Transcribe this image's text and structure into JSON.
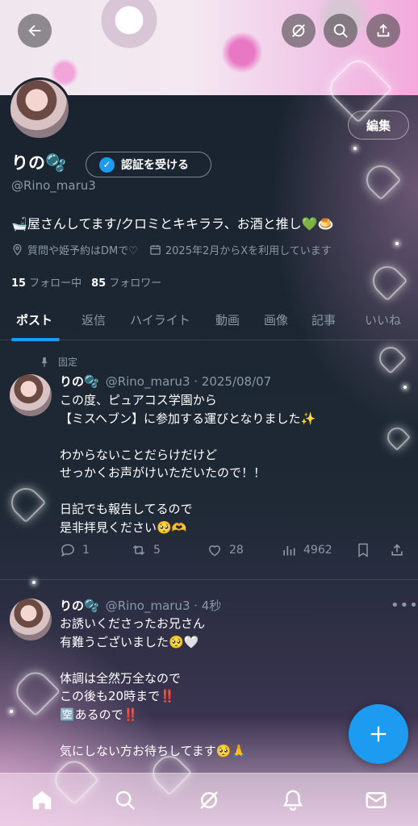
{
  "topbar": {
    "back_icon": "arrow-left-icon",
    "grok_icon": "grok-icon",
    "search_icon": "search-icon",
    "share_icon": "share-icon"
  },
  "profile": {
    "display_name": "りの🫧",
    "edit_label": "編集",
    "verify_label": "認証を受ける",
    "handle": "@Rino_maru3",
    "bio": "🛁屋さんしてます/クロミとキキララ、お酒と推し💚🍮",
    "info_note": "質問や姫予約はDMで♡",
    "joined": "2025年2月からXを利用しています",
    "following_count": "15",
    "following_label": "フォロー中",
    "followers_count": "85",
    "followers_label": "フォロワー"
  },
  "tabs": [
    "ポスト",
    "返信",
    "ハイライト",
    "動画",
    "画像",
    "記事",
    "いいね"
  ],
  "active_tab": "ポスト",
  "posts": [
    {
      "pinned_label": "固定",
      "name": "りの🫧",
      "meta": "@Rino_maru3 · 2025/08/07",
      "lines": [
        "この度、ピュアコス学園から",
        "【ミスヘブン】に参加する運びとなりました✨",
        "",
        "わからないことだらけだけど",
        "せっかくお声がけいただいたので！！",
        "",
        "日記でも報告してるので",
        "是非拝見ください🥺🫶"
      ],
      "replies": "1",
      "reposts": "5",
      "likes": "28",
      "views": "4962"
    },
    {
      "name": "りの🫧",
      "meta": "@Rino_maru3 · 4秒",
      "lines": [
        "お誘いくださったお兄さん",
        "有難うございました🥺🤍",
        "",
        "体調は全然万全なので",
        "この後も20時まで‼️",
        "🈳あるので‼️",
        "",
        "気にしない方お待ちしてます🥺🙏"
      ]
    }
  ],
  "fab_icon": "plus-icon",
  "bottom_nav": [
    "home-icon",
    "search-icon",
    "grok-icon",
    "bell-icon",
    "mail-icon"
  ],
  "colors": {
    "accent": "#1d9bf0",
    "background": "#1d2631",
    "muted_text": "#8b98a5"
  }
}
